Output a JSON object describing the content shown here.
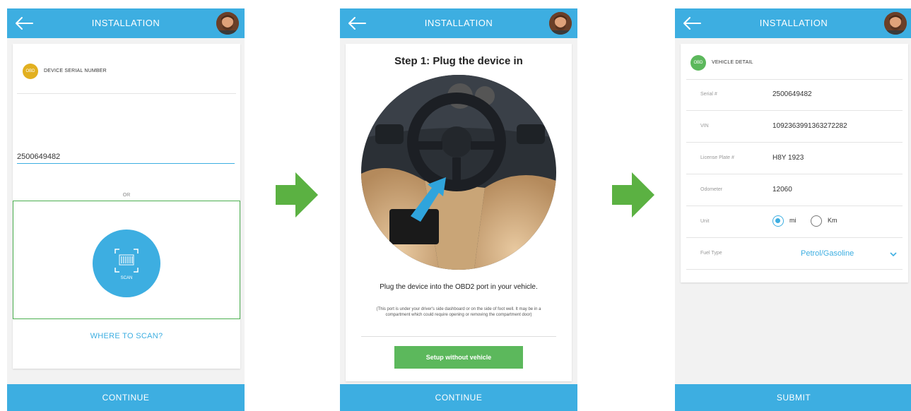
{
  "colors": {
    "primary": "#3daee1",
    "accent_green": "#5cb85c",
    "arrow_green": "#5bb142",
    "scan_box_border": "#4caf50",
    "obd_badge": "#e2b020"
  },
  "screen1": {
    "title": "INSTALLATION",
    "section_badge": "OBD",
    "section_title": "DEVICE SERIAL NUMBER",
    "serial_value": "2500649482",
    "or_text": "OR",
    "scan_label": "SCAN",
    "where_to_scan": "WHERE TO SCAN?",
    "continue_label": "CONTINUE"
  },
  "screen2": {
    "title": "INSTALLATION",
    "step_title": "Step 1: Plug the device in",
    "instruction": "Plug the device into the OBD2 port in your vehicle.",
    "instruction_detail": "(This port is under your driver's side dashboard or on the side of foot well. It may be in a compartment which could require opening or removing the compartment door)",
    "setup_label": "Setup without vehicle",
    "continue_label": "CONTINUE"
  },
  "screen3": {
    "title": "INSTALLATION",
    "section_badge": "OBD",
    "section_title": "VEHICLE DETAIL",
    "rows": [
      {
        "label": "Serial #",
        "value": "2500649482"
      },
      {
        "label": "VIN",
        "value": "1092363991363272282"
      },
      {
        "label": "License Plate #",
        "value": "H8Y 1923"
      },
      {
        "label": "Odometer",
        "value": "12060"
      }
    ],
    "unit": {
      "label": "Unit",
      "option_mi": "mi",
      "option_km": "Km",
      "selected": "mi"
    },
    "fuel": {
      "label": "Fuel Type",
      "value": "Petrol/Gasoline"
    },
    "submit_label": "SUBMIT"
  }
}
